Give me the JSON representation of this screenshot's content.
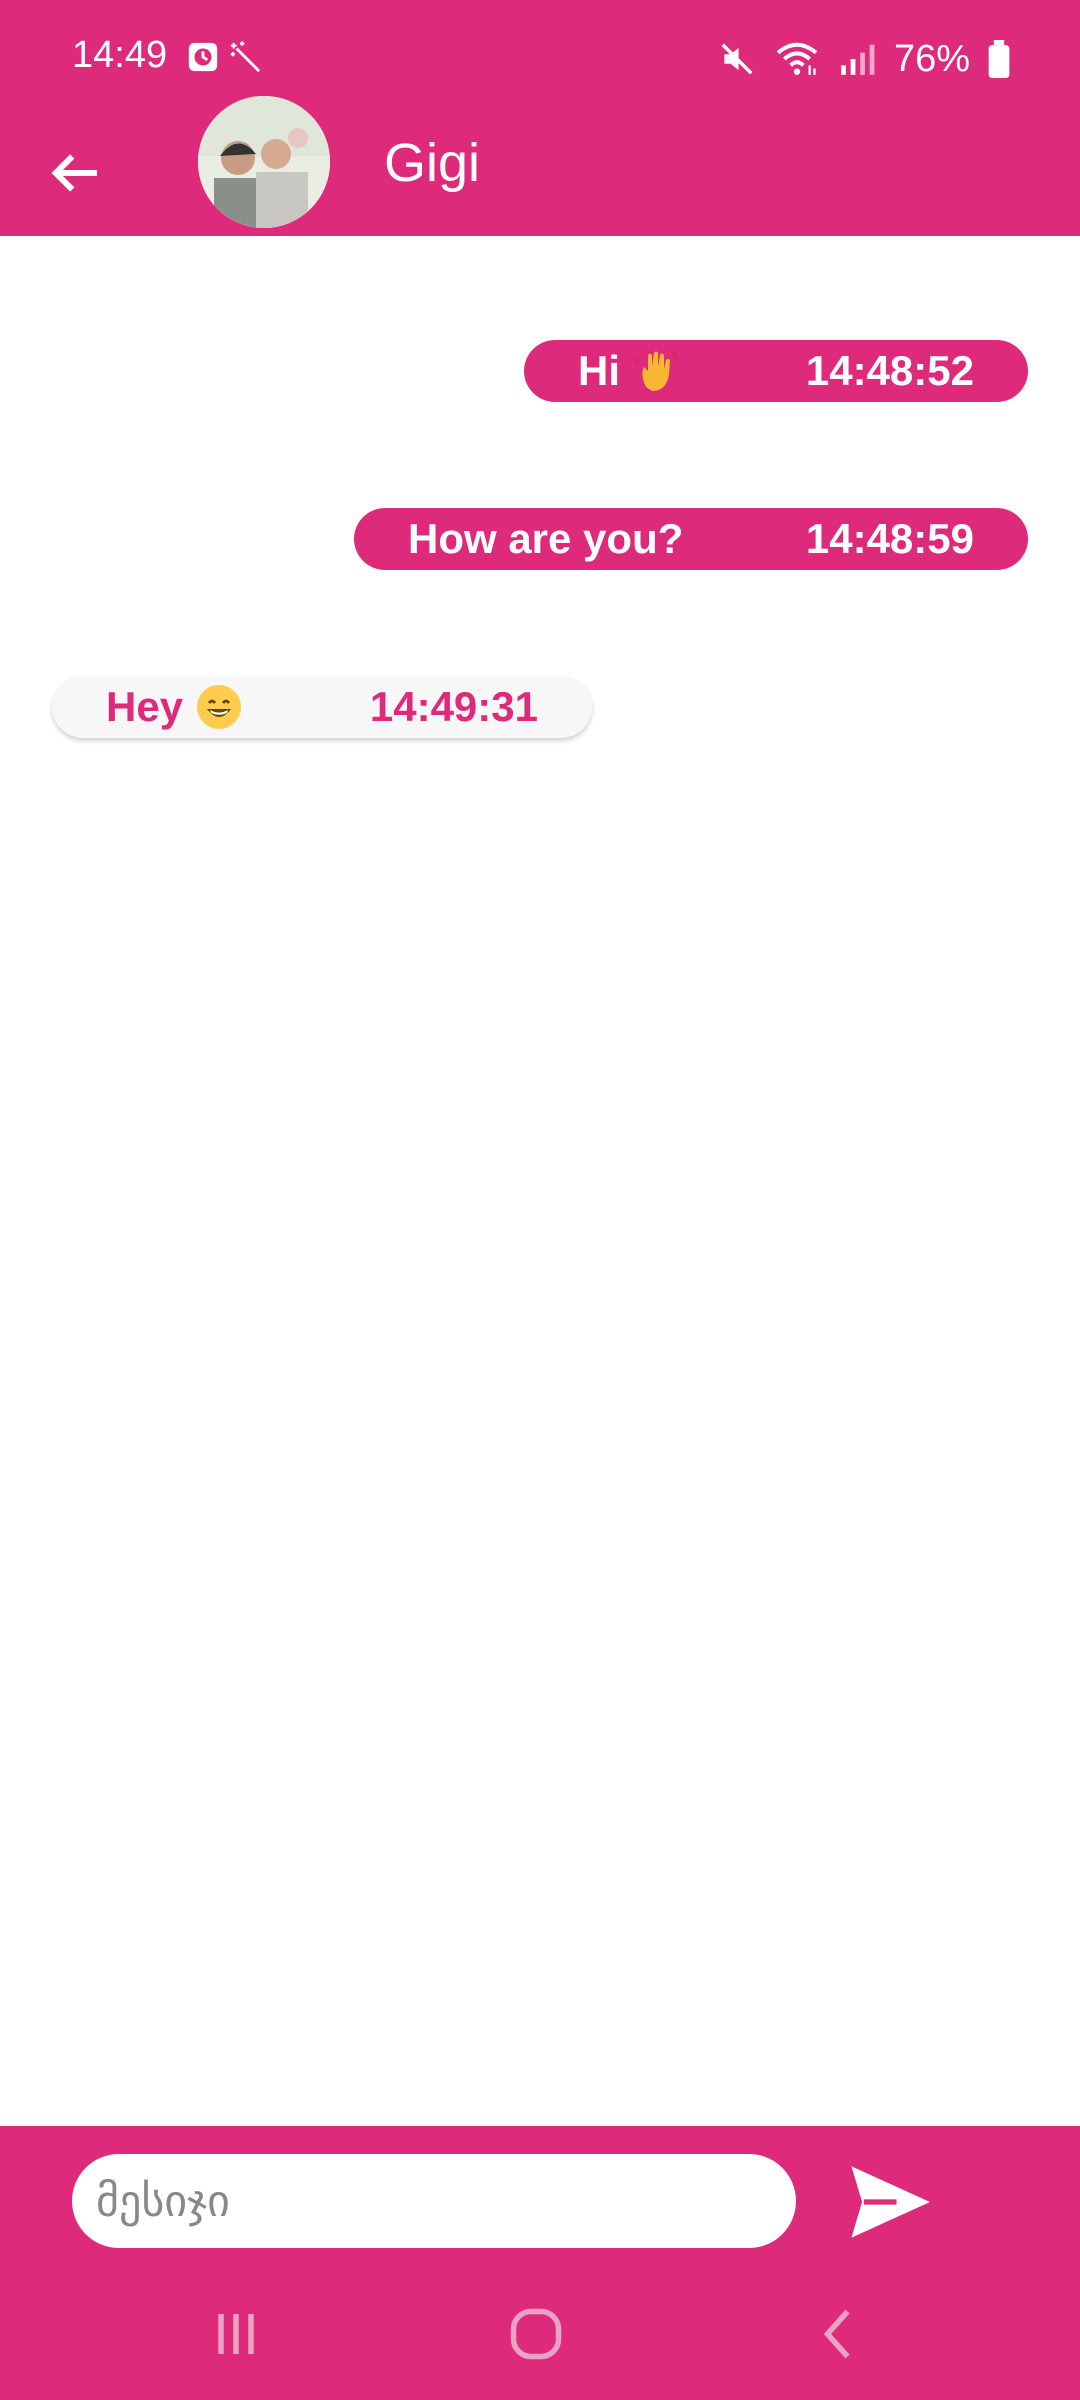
{
  "status_bar": {
    "time": "14:49",
    "battery": "76%",
    "icons": [
      "alarm-icon",
      "magic-wand-icon",
      "mute-icon",
      "wifi-icon",
      "signal-icon",
      "battery-icon"
    ]
  },
  "header": {
    "contact_name": "Gigi",
    "icons": [
      "back-arrow-icon",
      "avatar"
    ]
  },
  "messages": [
    {
      "direction": "outgoing",
      "text": "Hi",
      "emoji": "waving-hand-emoji",
      "time": "14:48:52"
    },
    {
      "direction": "outgoing",
      "text": "How are you?",
      "emoji": "",
      "time": "14:48:59"
    },
    {
      "direction": "incoming",
      "text": "Hey",
      "emoji": "grinning-face-emoji",
      "time": "14:49:31"
    }
  ],
  "composer": {
    "placeholder": "მესიჯი",
    "value": "",
    "send_icon": "send-icon"
  },
  "navigation": {
    "buttons": [
      "recent-apps-icon",
      "home-icon",
      "back-icon"
    ]
  },
  "colors": {
    "primary": "#de2a7b",
    "incoming_bubble": "#f7f7f7",
    "background": "#ffffff"
  }
}
